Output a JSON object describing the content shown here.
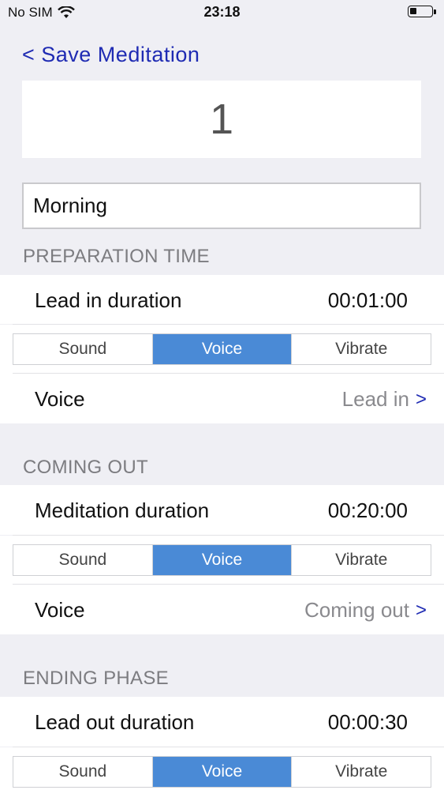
{
  "status": {
    "carrier": "No SIM",
    "time": "23:18"
  },
  "nav": {
    "back_label": "< Save Meditation"
  },
  "meditation_number": "1",
  "name_field": {
    "value": "Morning"
  },
  "sections": {
    "preparation": {
      "header": "PREPARATION TIME",
      "duration_label": "Lead in duration",
      "duration_value": "00:01:00",
      "segments": [
        "Sound",
        "Voice",
        "Vibrate"
      ],
      "voice_label": "Voice",
      "voice_value": "Lead in"
    },
    "coming_out": {
      "header": "COMING OUT",
      "duration_label": "Meditation duration",
      "duration_value": "00:20:00",
      "segments": [
        "Sound",
        "Voice",
        "Vibrate"
      ],
      "voice_label": "Voice",
      "voice_value": "Coming out"
    },
    "ending": {
      "header": "ENDING PHASE",
      "duration_label": "Lead out duration",
      "duration_value": "00:00:30",
      "segments": [
        "Sound",
        "Voice",
        "Vibrate"
      ]
    }
  },
  "selected_segment": "Voice",
  "colors": {
    "accent": "#1f2bb3",
    "segment_active": "#4a8ad6",
    "background": "#efeff4"
  }
}
